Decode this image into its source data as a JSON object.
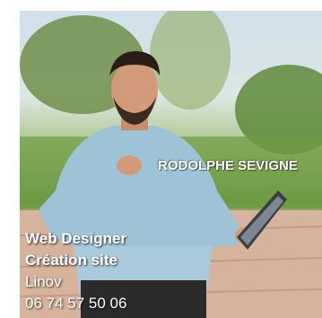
{
  "card": {
    "name": "RODOLPHE SEVIGNE",
    "lines": [
      "Web Designer",
      "Création site",
      "Linov",
      "06 74 57 50 06"
    ]
  },
  "colors": {
    "sky": "#dce7e3",
    "foliage": "#6f9a44",
    "shirt": "#9fc3d6",
    "pavement": "#d8b8a2",
    "text": "#ffffff"
  }
}
